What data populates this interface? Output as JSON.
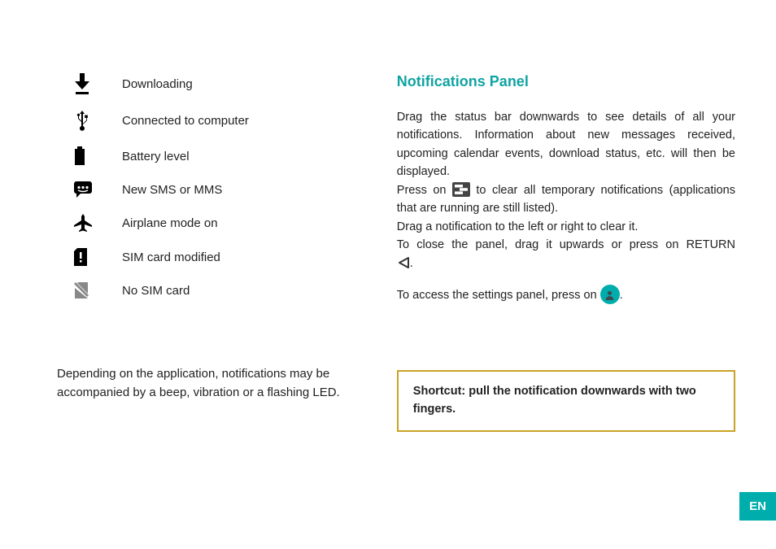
{
  "icons": {
    "downloading": "Downloading",
    "usb": "Connected to computer",
    "battery": "Battery level",
    "sms": "New SMS or MMS",
    "airplane": "Airplane mode on",
    "sim_modified": "SIM card modified",
    "no_sim": "No SIM card"
  },
  "left_note": "Depending on the application, notifications may be accompanied by a beep, vibration or a flashing LED.",
  "right": {
    "title": "Notifications Panel",
    "p1": "Drag the status bar downwards to see details of all your notifications. Information about new messages received, upcoming calendar events, download status, etc. will then be displayed.",
    "p2a": "Press on ",
    "p2b": " to clear all temporary notifications (applications that are running are still listed).",
    "p3": "Drag a notification to the left or right to clear it.",
    "p4a": "To close the panel, drag it upwards or press on RETURN ",
    "p4b": ".",
    "p5a": "To access the settings panel, press on ",
    "p5b": "."
  },
  "shortcut": "Shortcut: pull the notification downwards with two fingers.",
  "lang": "EN"
}
